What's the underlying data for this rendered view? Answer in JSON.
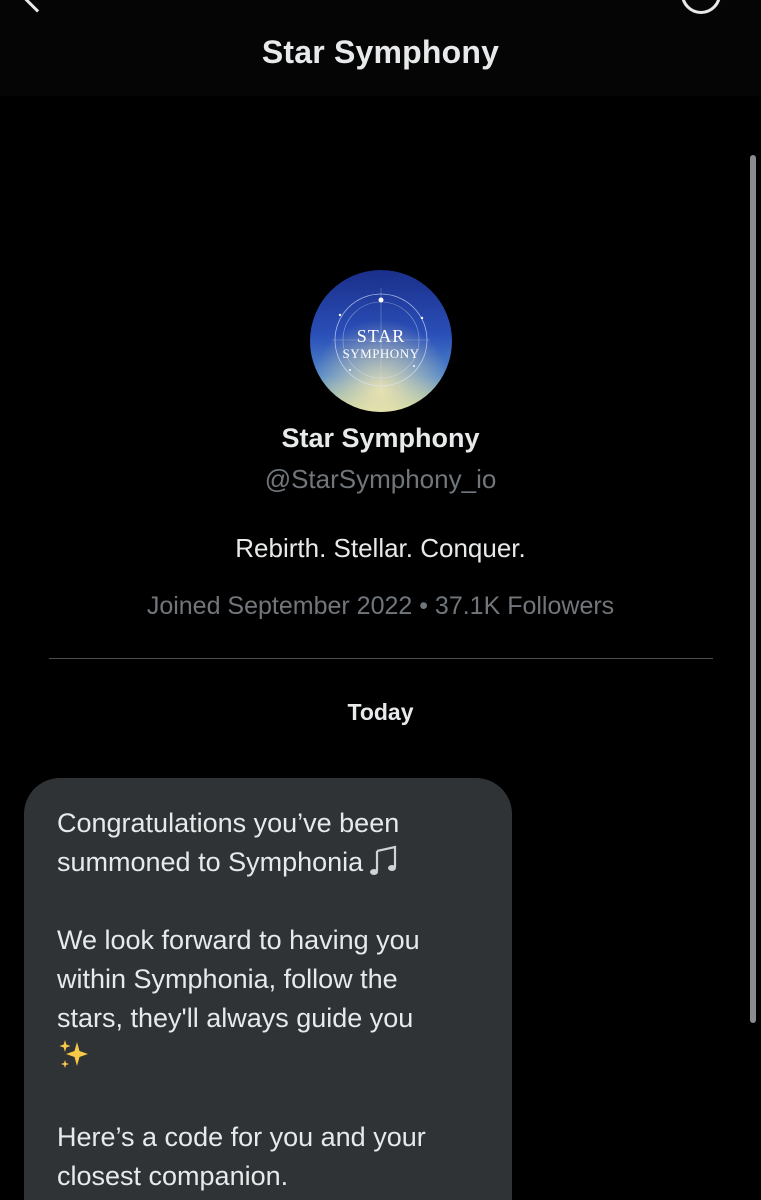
{
  "header": {
    "title": "Star Symphony",
    "back_icon": "chevron-left-icon",
    "info_icon": "info-icon"
  },
  "profile": {
    "avatar_logo": [
      "STAR",
      "SYMPHONY"
    ],
    "name": "Star Symphony",
    "handle": "@StarSymphony_io",
    "bio": "Rebirth. Stellar. Conquer.",
    "meta": "Joined September 2022 • 37.1K Followers"
  },
  "conversation": {
    "date_separator": "Today",
    "message": {
      "line1": "Congratulations you’ve been",
      "line2": "summoned to Symphonia",
      "line2_emoji": "musical-notes-icon",
      "line3": "We look forward to having you",
      "line4": "within Symphonia, follow the",
      "line5": "stars, they'll always guide you",
      "line6_emoji": "sparkles-icon",
      "line7": "Here’s a code for you and your",
      "line8": "closest companion."
    }
  },
  "colors": {
    "background": "#000000",
    "bubble": "#2f3336",
    "primary_text": "#e7e9ea",
    "secondary_text": "#71767b"
  }
}
